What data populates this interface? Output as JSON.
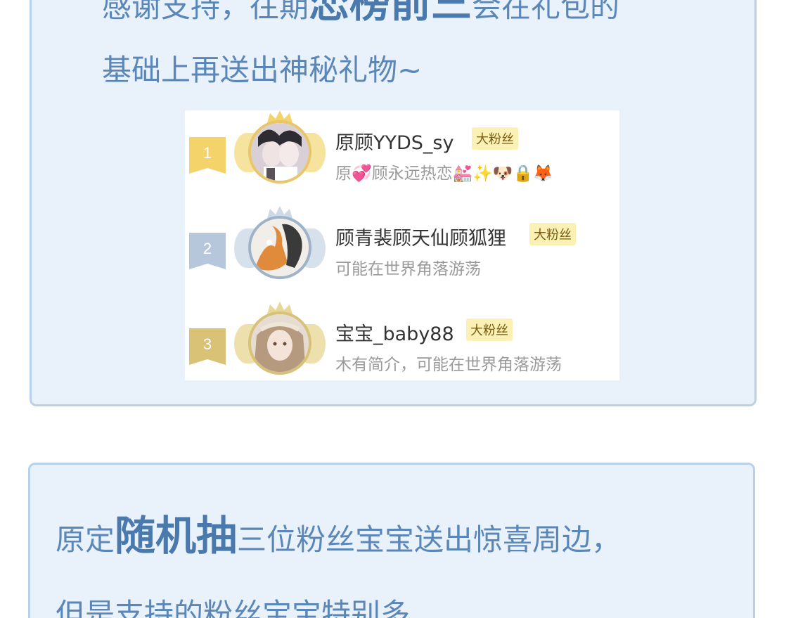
{
  "top_card": {
    "line1_before": "感谢支持，往期",
    "line1_emph": "恋榜前三",
    "line1_after": "会在礼包的",
    "line2": "基础上再送出神秘礼物~"
  },
  "fan_list": [
    {
      "rank": "1",
      "name": "原顾YYDS_sy",
      "badge": "大粉丝",
      "bio": "原💞顾永远热恋💒✨🐶🔒🦊",
      "ribbon_color": "#f3d36a",
      "wing_color": "#f4dc84"
    },
    {
      "rank": "2",
      "name": "顾青裴顾天仙顾狐狸",
      "badge": "大粉丝",
      "bio": "可能在世界角落游荡",
      "ribbon_color": "#b7c7db",
      "wing_color": "#cdd9e6"
    },
    {
      "rank": "3",
      "name": "宝宝_baby88",
      "badge": "大粉丝",
      "bio": "木有简介，可能在世界角落游荡",
      "ribbon_color": "#d9c276",
      "wing_color": "#e8d898"
    }
  ],
  "bottom_card": {
    "line1_before": "原定",
    "line1_emph": "随机抽",
    "line1_after": "三位粉丝宝宝送出惊喜周边，",
    "line2": "但是支持的粉丝宝宝特别多"
  }
}
